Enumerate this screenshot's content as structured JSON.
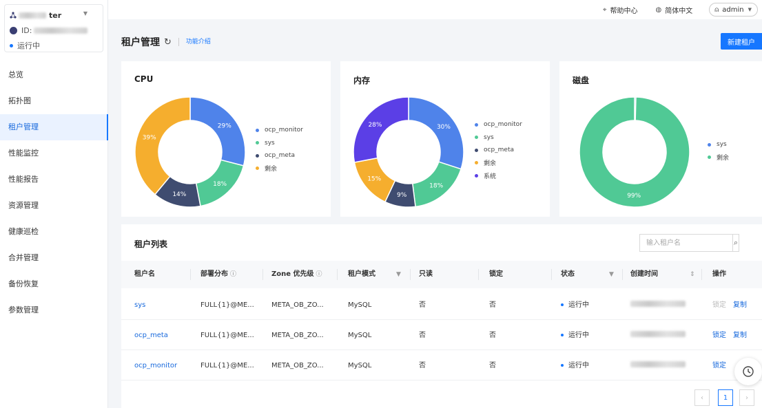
{
  "sidebar": {
    "cluster": {
      "name": "ter",
      "id_label": "ID:",
      "status": "运行中"
    },
    "items": [
      {
        "label": "总览",
        "active": false
      },
      {
        "label": "拓扑图",
        "active": false
      },
      {
        "label": "租户管理",
        "active": true
      },
      {
        "label": "性能监控",
        "active": false
      },
      {
        "label": "性能报告",
        "active": false
      },
      {
        "label": "资源管理",
        "active": false
      },
      {
        "label": "健康巡检",
        "active": false
      },
      {
        "label": "合并管理",
        "active": false
      },
      {
        "label": "备份恢复",
        "active": false
      },
      {
        "label": "参数管理",
        "active": false
      }
    ]
  },
  "topbar": {
    "help": "帮助中心",
    "language": "简体中文",
    "user": "admin"
  },
  "header": {
    "title": "租户管理",
    "intro": "功能介绍",
    "new_button": "新建租户"
  },
  "colors": {
    "blue": "#4f83ea",
    "green": "#50c995",
    "navy": "#3f4c70",
    "orange": "#f5ae2e",
    "purple": "#5b3fe6",
    "accent": "#1677ff"
  },
  "charts": [
    {
      "type": "pie",
      "title": "CPU",
      "slices": [
        {
          "name": "ocp_monitor",
          "value": 29,
          "label": "29%",
          "color": "#4f83ea"
        },
        {
          "name": "sys",
          "value": 18,
          "label": "18%",
          "color": "#50c995"
        },
        {
          "name": "ocp_meta",
          "value": 14,
          "label": "14%",
          "color": "#3f4c70"
        },
        {
          "name": "剩余",
          "value": 39,
          "label": "39%",
          "color": "#f5ae2e"
        }
      ]
    },
    {
      "type": "pie",
      "title": "内存",
      "slices": [
        {
          "name": "ocp_monitor",
          "value": 30,
          "label": "30%",
          "color": "#4f83ea"
        },
        {
          "name": "sys",
          "value": 18,
          "label": "18%",
          "color": "#50c995"
        },
        {
          "name": "ocp_meta",
          "value": 9,
          "label": "9%",
          "color": "#3f4c70"
        },
        {
          "name": "剩余",
          "value": 15,
          "label": "15%",
          "color": "#f5ae2e"
        },
        {
          "name": "系统",
          "value": 28,
          "label": "28%",
          "color": "#5b3fe6"
        }
      ]
    },
    {
      "type": "pie",
      "title": "磁盘",
      "slices": [
        {
          "name": "sys",
          "value": 0.4,
          "label": "0%",
          "color": "#4f83ea"
        },
        {
          "name": "剩余",
          "value": 99.6,
          "label": "99%",
          "color": "#50c995"
        }
      ]
    }
  ],
  "table": {
    "title": "租户列表",
    "search_placeholder": "输入租户名",
    "columns": [
      "租户名",
      "部署分布",
      "Zone 优先级",
      "租户模式",
      "只读",
      "锁定",
      "状态",
      "创建时间",
      "操作"
    ],
    "rows": [
      {
        "name": "sys",
        "distribution": "FULL{1}@ME...",
        "zone": "META_OB_ZO...",
        "mode": "MySQL",
        "readonly": "否",
        "locked": "否",
        "status": "运行中",
        "lock_action": "锁定",
        "lock_disabled": true,
        "copy_action": "复制"
      },
      {
        "name": "ocp_meta",
        "distribution": "FULL{1}@ME...",
        "zone": "META_OB_ZO...",
        "mode": "MySQL",
        "readonly": "否",
        "locked": "否",
        "status": "运行中",
        "lock_action": "锁定",
        "lock_disabled": false,
        "copy_action": "复制"
      },
      {
        "name": "ocp_monitor",
        "distribution": "FULL{1}@ME...",
        "zone": "META_OB_ZO...",
        "mode": "MySQL",
        "readonly": "否",
        "locked": "否",
        "status": "运行中",
        "lock_action": "锁定",
        "lock_disabled": false,
        "copy_action": ""
      }
    ],
    "pagination": {
      "prev": "‹",
      "current": "1",
      "next": "›"
    }
  }
}
